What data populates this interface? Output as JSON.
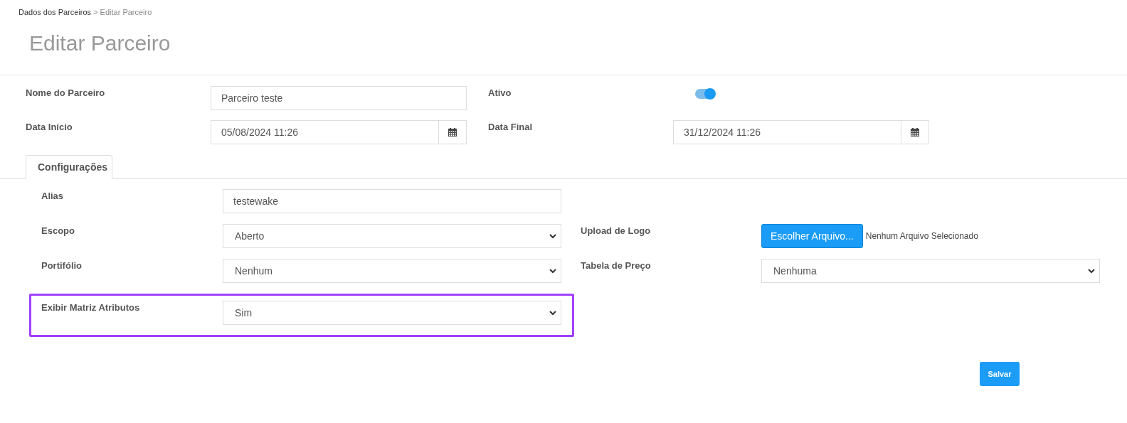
{
  "breadcrumb": [
    {
      "label": "Dados dos Parceiros",
      "kind": "link"
    },
    {
      "label": "> Editar Parceiro",
      "kind": "current"
    }
  ],
  "title": "Editar Parceiro",
  "header_fields": [
    {
      "label": "Nome do Parceiro",
      "kind": "text",
      "value": "Parceiro teste"
    },
    {
      "label": "Ativo",
      "kind": "toggle",
      "on": true
    },
    {
      "label": "Data Início",
      "kind": "date",
      "value": "05/08/2024 11:26"
    },
    {
      "label": "Data Final",
      "kind": "date",
      "value": "31/12/2024 11:26"
    }
  ],
  "tabs": [
    {
      "label": "Configurações",
      "selected": true
    }
  ],
  "config_left": [
    {
      "label": "Alias",
      "kind": "text",
      "value": "testewake",
      "highlighted": false
    },
    {
      "label": "Escopo",
      "kind": "select",
      "value": "Aberto",
      "highlighted": false
    },
    {
      "label": "Portifólio",
      "kind": "select",
      "value": "Nenhum",
      "highlighted": false
    },
    {
      "label": "Exibir Matriz Atributos",
      "kind": "select",
      "value": "Sim",
      "highlighted": true
    }
  ],
  "config_right": [
    {
      "label": "Upload de Logo",
      "kind": "file",
      "button": "Escolher Arquivo...",
      "status": "Nenhum Arquivo Selecionado"
    },
    {
      "label": "Tabela de Preço",
      "kind": "select",
      "value": "Nenhuma"
    }
  ],
  "save_button": "Salvar"
}
